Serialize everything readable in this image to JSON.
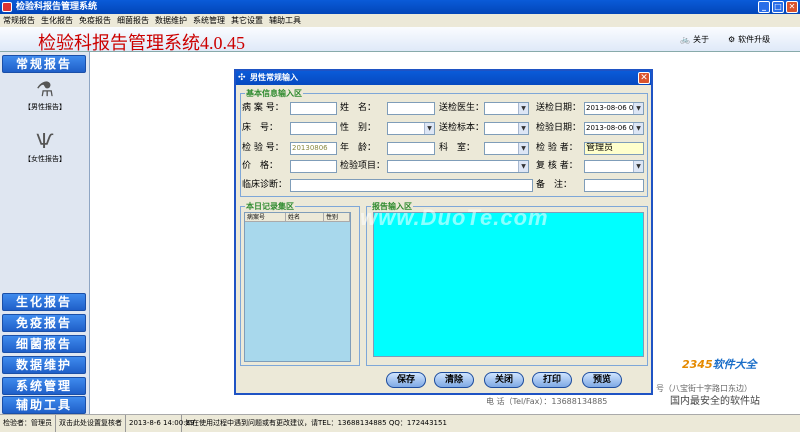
{
  "app": {
    "window_title": "检验科报告管理系统",
    "heading": "检验科报告管理系统4.0.45",
    "header_links": {
      "about": "关于",
      "upgrade": "软件升级"
    }
  },
  "menu": [
    "常规报告",
    "生化报告",
    "免疫报告",
    "细菌报告",
    "数据维护",
    "系统管理",
    "其它设置",
    "辅助工具"
  ],
  "sidebar": {
    "top_button": "常规报告",
    "icons": [
      {
        "label": "【男性报告】",
        "icon": "microscope-icon"
      },
      {
        "label": "【女性报告】",
        "icon": "female-icon"
      }
    ],
    "bottom_buttons": [
      "生化报告",
      "免疫报告",
      "细菌报告",
      "数据维护",
      "系统管理",
      "辅助工具"
    ]
  },
  "statusbar": {
    "checker": "检验者：管理员",
    "hint": "双击此处设置复核者",
    "datetime": "2013-8-6 14:00:39",
    "message": "如在使用过程中遇到问题或有更改建议，请TEL：13688134885 QQ：172443151"
  },
  "background_text": {
    "address": "号（八宝街十字路口东边）",
    "phone": "电 话（Tel/Fax）：13688134885"
  },
  "dialog": {
    "title": "男性常规输入",
    "basic_section": "基本信息输入区",
    "fields": {
      "case_no": "病 案 号：",
      "name": "姓　名：",
      "sender_doctor": "送检医生：",
      "sender_date": "送检日期：",
      "sender_date_value": "2013-08-06 01:",
      "bed_no": "床　号：",
      "gender": "性　别：",
      "specimen": "送检标本：",
      "check_date": "检验日期：",
      "check_date_value": "2013-08-06 02:",
      "check_no": "检 验 号：",
      "check_no_value": "20130806",
      "age": "年　龄：",
      "department": "科　室：",
      "examiner": "检 验 者：",
      "examiner_value": "管理员",
      "price": "价　格：",
      "items": "检验项目：",
      "reviewer": "复 核 者：",
      "diagnosis": "临床诊断：",
      "remark": "备　注："
    },
    "today_section": "本日记录集区",
    "today_columns": [
      "病案号",
      "姓名",
      "性别"
    ],
    "report_section": "报告输入区",
    "buttons": {
      "save": "保存",
      "clear": "清除",
      "close": "关闭",
      "print": "打印",
      "preview": "预览"
    }
  },
  "watermark": "www.DuoTe.com",
  "corner_brand": {
    "part1": "2345",
    "part2": "软件大全",
    "slogan": "国内最安全的软件站"
  },
  "colors": {
    "title_red": "#cc0000",
    "section_green": "#2d8a2d",
    "report_area": "#00ffff"
  }
}
